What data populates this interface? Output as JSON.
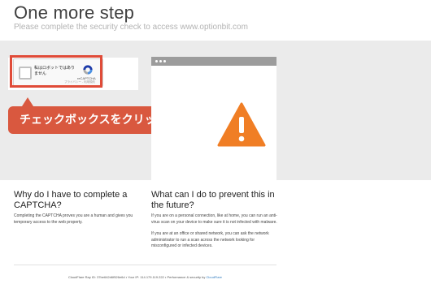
{
  "header": {
    "title": "One more step",
    "subtitle": "Please complete the security check to access www.optionbit.com"
  },
  "captcha": {
    "checkbox_label_line1": "私はロボットではあり",
    "checkbox_label_line2": "ません",
    "brand": "reCAPTCHA",
    "links": "プライバシー - 利用規約"
  },
  "callout": {
    "text": "チェックボックスをクリック",
    "color": "#d9583f"
  },
  "highlight_color": "#e04b38",
  "warning_icon": "warning-triangle-icon",
  "left_section": {
    "title": "Why do I have to complete a CAPTCHA?",
    "paragraphs": [
      "Completing the CAPTCHA proves you are a human and gives you temporary access to the web property."
    ]
  },
  "right_section": {
    "title": "What can I do to prevent this in the future?",
    "paragraphs": [
      "If you are on a personal connection, like at home, you can run an anti-virus scan on your device to make sure it is not infected with malware.",
      "If you are at an office or shared network, you can ask the network administrator to run a scan across the network looking for misconfigured or infected devices."
    ]
  },
  "footer": {
    "ray_label": "CloudFlare Ray ID: 37be642d6f526e6d",
    "ip_label": "Your IP: 114.179.119.222",
    "perf_label": "Performance & security by",
    "provider": "CloudFlare",
    "separator": "•"
  }
}
